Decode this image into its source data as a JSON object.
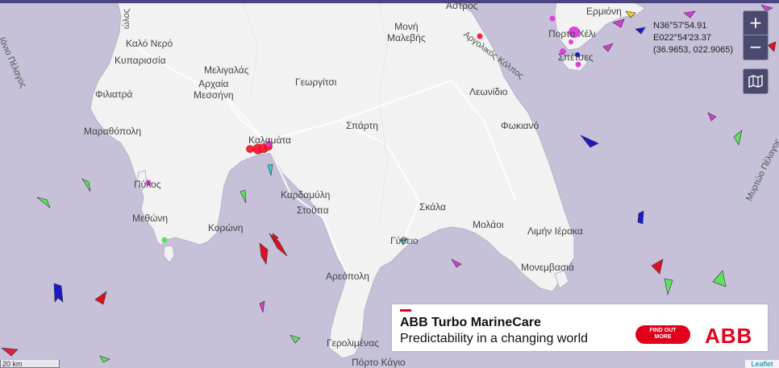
{
  "map": {
    "place_labels": {
      "astros": "Άστρος",
      "ermioni": "Ερμιόνη",
      "porto_cheli": "Πορτο Χέλι",
      "spetses": "Σπέτσες",
      "argolikos": "Αργολικός Κόλπος",
      "ionio": "Ιόνιο Πέλαγος",
      "kalo_nero": "Καλό Νερό",
      "kyparissia": "Κυπαρισσία",
      "meligalas": "Μελιγαλάς",
      "archaia_messini": "Αρχαία\nΜεσσήνη",
      "moni_malevis": "Μονή\nΜαλεβής",
      "georgitsi": "Γεωργίτσι",
      "filiatra": "Φιλιατρά",
      "leonidio": "Λεωνίδιο",
      "marathoupoli": "Μαραθόπολη",
      "sparti": "Σπάρτη",
      "fokiano": "Φωκιανό",
      "kalamata": "Καλαμάτα",
      "pylos": "Πύλος",
      "kardamyli": "Καρδαμύλη",
      "methoni": "Μεθώνη",
      "stoupa": "Στούπα",
      "skala": "Σκάλα",
      "koroni": "Κορώνη",
      "molaoi": "Μολάοι",
      "limin_ieraka": "Λιμήν Ιέρακα",
      "gytheio": "Γύθειο",
      "monemvasia": "Μονεμβασιά",
      "areopoli": "Αρεόπολη",
      "gerolimenas": "Γερολιμένας",
      "porto_kagio": "Πόρτο Κάγιο",
      "myrtoo": "Μυρτώο Πέλαγος",
      "top_left_cut": "ώλος"
    },
    "coords": {
      "lat": "N36°57'54.91",
      "lon": "E022°54'23.37",
      "decimal": "(36.9653, 022.9065)"
    },
    "controls": {
      "zoom_in": "+",
      "zoom_out": "−"
    },
    "scale_label": "20 km",
    "attribution": "Leaflet",
    "colors": {
      "sea": "#c6c0d8",
      "land": "#f2f2f2",
      "accent_red": "#e2001a"
    }
  },
  "ad": {
    "title": "ABB Turbo MarineCare",
    "tagline": "Predictability in a changing world",
    "cta": "FIND OUT\nMORE",
    "logo": "ABB"
  }
}
